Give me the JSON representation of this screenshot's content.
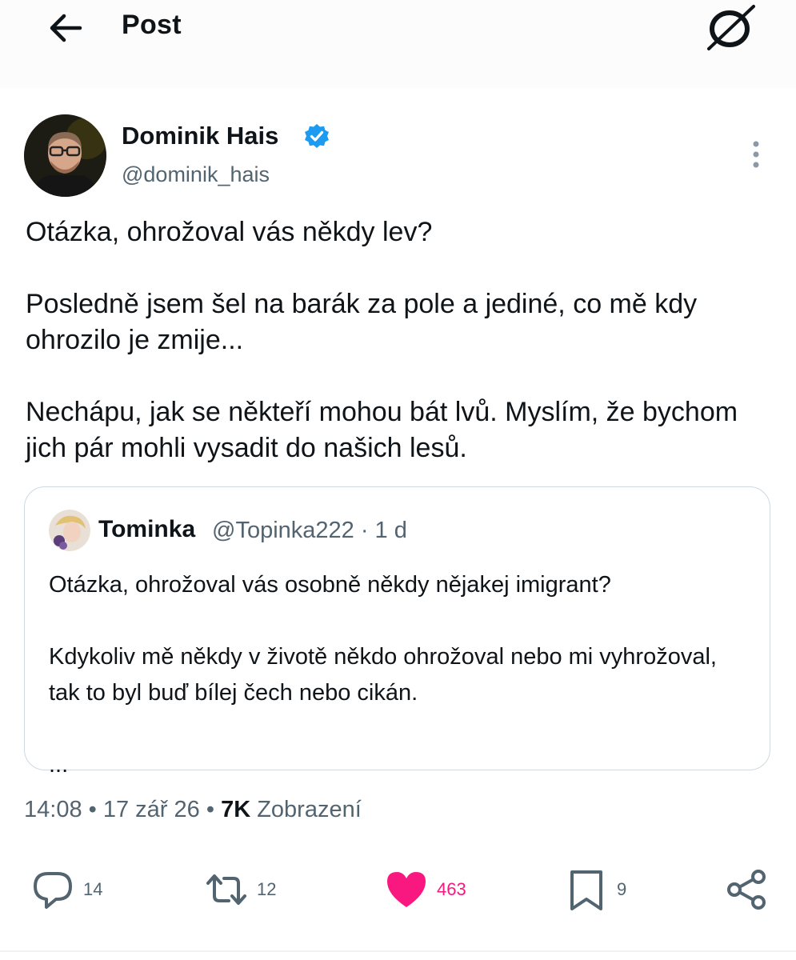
{
  "header": {
    "title": "Post",
    "back_icon": "arrow-left-icon",
    "logo_icon": "x-logo-icon"
  },
  "author": {
    "name": "Dominik Hais",
    "handle": "@dominik_hais",
    "verified": true,
    "verified_color": "#1d9bf0"
  },
  "tweet": {
    "paragraphs": [
      "Otázka, ohrožoval vás někdy lev?",
      "Posledně jsem šel na barák za pole a jediné, co mě kdy ohrozilo je zmije...",
      "Nechápu, jak se někteří mohou bát lvů. Myslím, že bychom jich pár mohli vysadit do našich lesů."
    ]
  },
  "quote": {
    "name": "Tominka",
    "handle_time": "@Topinka222 · 1 d",
    "paragraphs": [
      "Otázka, ohrožoval vás osobně někdy nějakej imigrant?",
      "Kdykoliv mě někdy v životě někdo ohrožoval nebo mi vyhrožoval, tak to byl buď bílej čech nebo cikán.",
      "..."
    ]
  },
  "meta": {
    "time": "14:08",
    "separator1": " • ",
    "date": "17 zář 26",
    "separator2": " • ",
    "views_count": "7K",
    "views_label": " Zobrazení"
  },
  "actions": {
    "reply": {
      "icon": "reply-icon",
      "count": "14"
    },
    "retweet": {
      "icon": "retweet-icon",
      "count": "12"
    },
    "like": {
      "icon": "heart-filled-icon",
      "count": "463",
      "color": "#f91880"
    },
    "bookmark": {
      "icon": "bookmark-icon",
      "count": "9"
    },
    "share": {
      "icon": "share-icon"
    }
  }
}
